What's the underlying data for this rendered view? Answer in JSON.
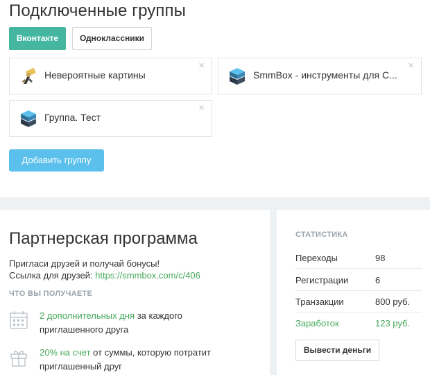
{
  "groups_section": {
    "title": "Подключенные группы",
    "tabs": [
      {
        "label": "Вконтакте",
        "active": true
      },
      {
        "label": "Одноклассники",
        "active": false
      }
    ],
    "groups": [
      {
        "name": "Невероятные картины",
        "icon": "painting-icon"
      },
      {
        "name": "SmmBox - инструменты для С...",
        "icon": "smmbox-logo-icon"
      },
      {
        "name": "Группа. Тест",
        "icon": "smmbox-logo-icon"
      }
    ],
    "close_glyph": "×",
    "add_button_label": "Добавить группу"
  },
  "partner": {
    "title": "Партнерская программа",
    "invite_text": "Пригласи друзей и получай бонусы!",
    "ref_label": "Ссылка для друзей:",
    "ref_link": "https://smmbox.com/c/406",
    "what_you_get": "ЧТО ВЫ ПОЛУЧАЕТЕ",
    "benefits": [
      {
        "highlight": "2 дополнительных дня",
        "text": " за каждого приглашенного друга",
        "icon": "calendar-icon"
      },
      {
        "highlight": "20% на счет",
        "text": " от суммы, которую потратит приглашенный друг",
        "icon": "gift-icon"
      }
    ]
  },
  "stats": {
    "title": "СТАТИСТИКА",
    "rows": [
      {
        "label": "Переходы",
        "value": "98"
      },
      {
        "label": "Регистрации",
        "value": "6"
      },
      {
        "label": "Транзакции",
        "value": "800 руб."
      },
      {
        "label": "Заработок",
        "value": "123 руб."
      }
    ],
    "withdraw_label": "Вывести деньги"
  },
  "colors": {
    "accent_teal": "#45b7a1",
    "button_blue": "#5bc0eb",
    "link_green": "#45a85b",
    "page_background": "#eef1f4"
  }
}
